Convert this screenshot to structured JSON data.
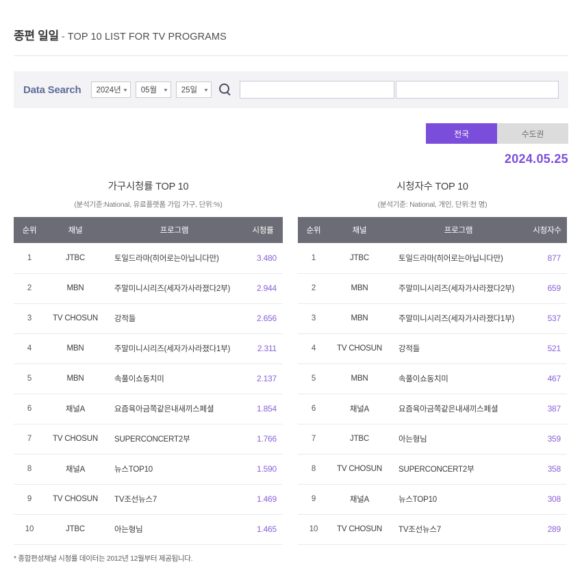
{
  "header": {
    "title_bold": "종편 일일",
    "separator": "-",
    "title_sub": "TOP 10 LIST FOR TV PROGRAMS"
  },
  "search": {
    "label": "Data Search",
    "year": "2024년",
    "month": "05월",
    "day": "25일",
    "chevron": "⌄",
    "icon": "search-icon",
    "field_left_value": "",
    "field_right_value": ""
  },
  "region_toggle": {
    "active": "전국",
    "inactive": "수도권"
  },
  "date_display": "2024.05.25",
  "footnote": "* 종합편성채널 시청률 데이터는 2012년 12월부터 제공됩니다.",
  "tables": [
    {
      "title": "가구시청률 TOP 10",
      "subtitle": "(분석기준:National, 유료플랫폼 가입 가구, 단위:%)",
      "columns": [
        "순위",
        "채널",
        "프로그램",
        "시청률"
      ],
      "rows": [
        [
          "1",
          "JTBC",
          "토일드라마(히어로는아닙니다만)",
          "3.480"
        ],
        [
          "2",
          "MBN",
          "주말미니시리즈(세자가사라졌다2부)",
          "2.944"
        ],
        [
          "3",
          "TV CHOSUN",
          "강적들",
          "2.656"
        ],
        [
          "4",
          "MBN",
          "주말미니시리즈(세자가사라졌다1부)",
          "2.311"
        ],
        [
          "5",
          "MBN",
          "속풀이쇼동치미",
          "2.137"
        ],
        [
          "6",
          "채널A",
          "요즘육아금쪽같은내새끼스페셜",
          "1.854"
        ],
        [
          "7",
          "TV CHOSUN",
          "SUPERCONCERT2부",
          "1.766"
        ],
        [
          "8",
          "채널A",
          "뉴스TOP10",
          "1.590"
        ],
        [
          "9",
          "TV CHOSUN",
          "TV조선뉴스7",
          "1.469"
        ],
        [
          "10",
          "JTBC",
          "아는형님",
          "1.465"
        ]
      ]
    },
    {
      "title": "시청자수 TOP 10",
      "subtitle": "(분석기준: National, 개인, 단위:천 명)",
      "columns": [
        "순위",
        "채널",
        "프로그램",
        "시청자수"
      ],
      "rows": [
        [
          "1",
          "JTBC",
          "토일드라마(히어로는아닙니다만)",
          "877"
        ],
        [
          "2",
          "MBN",
          "주말미니시리즈(세자가사라졌다2부)",
          "659"
        ],
        [
          "3",
          "MBN",
          "주말미니시리즈(세자가사라졌다1부)",
          "537"
        ],
        [
          "4",
          "TV CHOSUN",
          "강적들",
          "521"
        ],
        [
          "5",
          "MBN",
          "속풀이쇼동치미",
          "467"
        ],
        [
          "6",
          "채널A",
          "요즘육아금쪽같은내새끼스페셜",
          "387"
        ],
        [
          "7",
          "JTBC",
          "아는형님",
          "359"
        ],
        [
          "8",
          "TV CHOSUN",
          "SUPERCONCERT2부",
          "358"
        ],
        [
          "9",
          "채널A",
          "뉴스TOP10",
          "308"
        ],
        [
          "10",
          "TV CHOSUN",
          "TV조선뉴스7",
          "289"
        ]
      ]
    }
  ],
  "colors": {
    "accent": "#7b4ddb",
    "header_row": "#6c6c76",
    "value_text": "#8a5fd8"
  }
}
